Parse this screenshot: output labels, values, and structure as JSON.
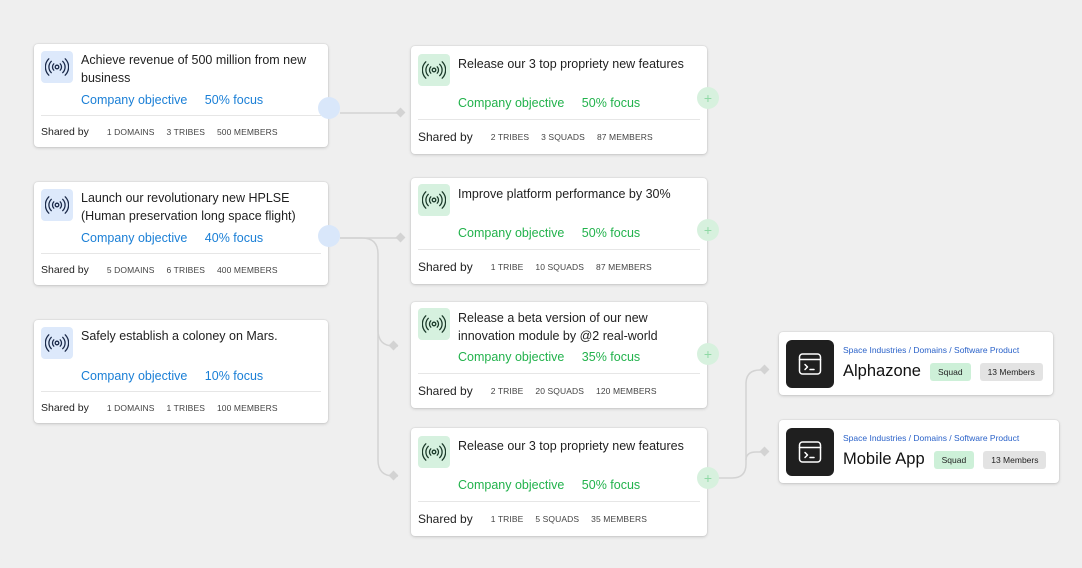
{
  "colors": {
    "background": "#efefef",
    "company_blue": "#1a7fd6",
    "focus_green": "#22b24c",
    "connector": "#d3d3d3",
    "node_blue": "#d9e7fa",
    "node_green": "#d7f1de",
    "breadcrumb_blue": "#2a62c9",
    "squad_tag": "#cdf0d8",
    "members_tag": "#e3e3e3"
  },
  "icons": {
    "objective": "radar-signal-icon",
    "team": "terminal-window-icon",
    "node_plus": "plus-icon"
  },
  "objectives": [
    {
      "title": "Achieve revenue of 500 million from new business",
      "type_label": "Company objective",
      "focus": "50% focus",
      "shared_label": "Shared by",
      "stats": [
        "1 DOMAINS",
        "3 TRIBES",
        "500 MEMBERS"
      ]
    },
    {
      "title": "Launch our revolutionary new HPLSE (Human preservation long space flight)",
      "type_label": "Company objective",
      "focus": "40% focus",
      "shared_label": "Shared by",
      "stats": [
        "5 DOMAINS",
        "6 TRIBES",
        "400 MEMBERS"
      ]
    },
    {
      "title": "Safely establish a coloney on Mars.",
      "type_label": "Company objective",
      "focus": "10% focus",
      "shared_label": "Shared by",
      "stats": [
        "1 DOMAINS",
        "1 TRIBES",
        "100 MEMBERS"
      ]
    }
  ],
  "key_results": [
    {
      "title": "Release our 3 top propriety new features",
      "type_label": "Company objective",
      "focus": "50% focus",
      "shared_label": "Shared by",
      "stats": [
        "2 TRIBES",
        "3 SQUADS",
        "87 MEMBERS"
      ]
    },
    {
      "title": "Improve platform performance by 30%",
      "type_label": "Company objective",
      "focus": "50% focus",
      "shared_label": "Shared by",
      "stats": [
        "1 TRIBE",
        "10 SQUADS",
        "87 MEMBERS"
      ]
    },
    {
      "title": "Release a beta version of our new innovation module by @2 real-world",
      "type_label": "Company objective",
      "focus": "35% focus",
      "shared_label": "Shared by",
      "stats": [
        "2 TRIBE",
        "20 SQUADS",
        "120 MEMBERS"
      ]
    },
    {
      "title": "Release our 3 top propriety new features",
      "type_label": "Company objective",
      "focus": "50% focus",
      "shared_label": "Shared by",
      "stats": [
        "1 TRIBE",
        "5 SQUADS",
        "35 MEMBERS"
      ]
    }
  ],
  "teams": [
    {
      "breadcrumb": "Space Industries / Domains / Software Product",
      "name": "Alphazone",
      "type_tag": "Squad",
      "members_tag": "13 Members"
    },
    {
      "breadcrumb": "Space Industries / Domains / Software Product",
      "name": "Mobile App",
      "type_tag": "Squad",
      "members_tag": "13 Members"
    }
  ]
}
